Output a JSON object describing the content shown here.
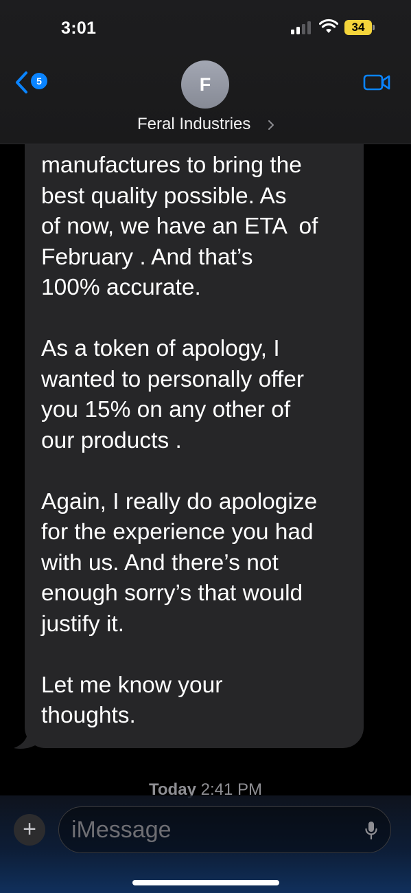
{
  "status_bar": {
    "time": "3:01",
    "battery": "34"
  },
  "nav": {
    "back_badge": "5",
    "avatar_initial": "F",
    "contact_name": "Feral Industries"
  },
  "message": {
    "lines": [
      "manufactures to bring the",
      "best quality possible. As",
      "of now, we have an ETA  of",
      "February . And that’s",
      "100% accurate.",
      "",
      "As a token of apology, I",
      "wanted to personally offer",
      "you 15% on any other of",
      "our products .",
      "",
      "Again, I really do apologize",
      "for the experience you had",
      "with us. And there’s not",
      "enough sorry’s that would",
      "justify it.",
      "",
      "Let me know your",
      "thoughts."
    ]
  },
  "timestamp": {
    "day": "Today",
    "time": "2:41 PM"
  },
  "composer": {
    "placeholder": "iMessage"
  },
  "colors": {
    "accent": "#0a84ff",
    "bubble": "#262628",
    "battery": "#f4d43b"
  }
}
